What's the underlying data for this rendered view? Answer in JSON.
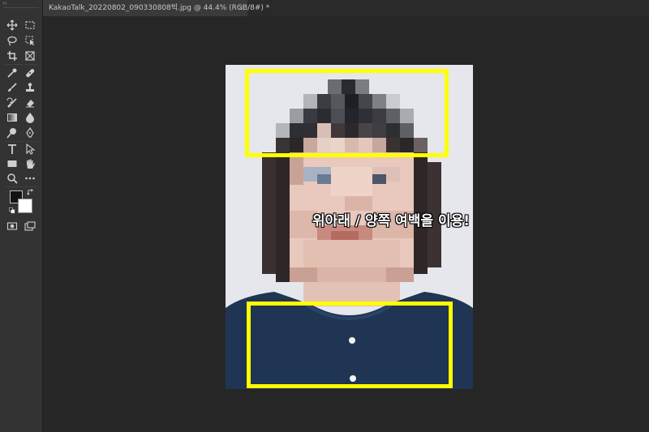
{
  "document_tab": {
    "title": "KakaoTalk_20220802_090330808빅.jpg @ 44.4% (RGB/8#) *",
    "close_glyph": "×"
  },
  "toolbar": {
    "collapse_glyph": "‹‹",
    "tools": [
      {
        "name": "move-tool",
        "icon": "move-icon",
        "glyph": "✥"
      },
      {
        "name": "marquee-tool",
        "icon": "rect-marquee-icon",
        "glyph": "⬚"
      },
      {
        "name": "lasso-tool",
        "icon": "lasso-icon",
        "glyph": "ꝋ"
      },
      {
        "name": "object-select-tool",
        "icon": "object-select-icon",
        "glyph": "⬚"
      },
      {
        "name": "crop-tool",
        "icon": "crop-icon",
        "glyph": "⌗"
      },
      {
        "name": "frame-tool",
        "icon": "frame-icon",
        "glyph": "⊠"
      },
      {
        "name": "eyedropper-tool",
        "icon": "eyedropper-icon",
        "glyph": "⟋"
      },
      {
        "name": "healing-brush-tool",
        "icon": "bandage-icon",
        "glyph": "✚"
      },
      {
        "name": "brush-tool",
        "icon": "brush-icon",
        "glyph": "⟋"
      },
      {
        "name": "clone-stamp-tool",
        "icon": "stamp-icon",
        "glyph": "⊥"
      },
      {
        "name": "history-brush-tool",
        "icon": "history-brush-icon",
        "glyph": "⟋"
      },
      {
        "name": "eraser-tool",
        "icon": "eraser-icon",
        "glyph": "◇"
      },
      {
        "name": "gradient-tool",
        "icon": "gradient-icon",
        "glyph": "▣"
      },
      {
        "name": "blur-tool",
        "icon": "droplet-icon",
        "glyph": "●"
      },
      {
        "name": "dodge-tool",
        "icon": "dodge-icon",
        "glyph": "●"
      },
      {
        "name": "pen-tool",
        "icon": "pen-icon",
        "glyph": "✒"
      },
      {
        "name": "type-tool",
        "icon": "type-icon",
        "glyph": "T"
      },
      {
        "name": "path-select-tool",
        "icon": "arrow-icon",
        "glyph": "↖"
      },
      {
        "name": "rectangle-tool",
        "icon": "rectangle-icon",
        "glyph": "▭"
      },
      {
        "name": "hand-tool",
        "icon": "hand-icon",
        "glyph": "✋"
      },
      {
        "name": "zoom-tool",
        "icon": "zoom-icon",
        "glyph": "⚲"
      },
      {
        "name": "more-tools",
        "icon": "ellipsis-icon",
        "glyph": "•••"
      }
    ],
    "swap_colors_glyph": "⇆",
    "default_colors_glyph": "◪",
    "quick_mask_glyph": "▣",
    "screen_mode_glyph": "⧉",
    "foreground_color": "#141414",
    "background_color": "#ffffff"
  },
  "canvas": {
    "annotation_text": "위아래 / 양쪽 여백을 이용!",
    "highlight_color": "#ffff00"
  }
}
